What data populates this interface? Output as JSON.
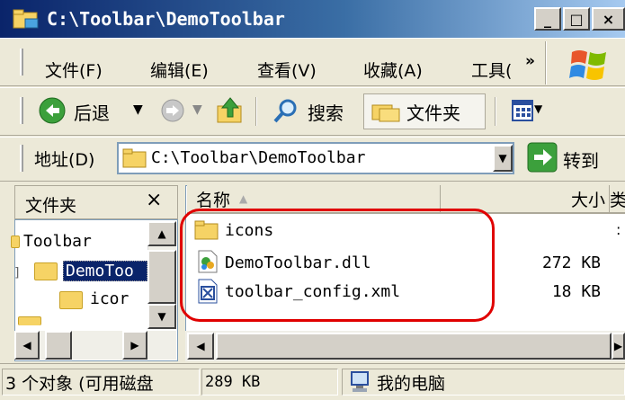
{
  "window": {
    "title": "C:\\Toolbar\\DemoToolbar",
    "controls": {
      "minimize": "_",
      "maximize": "□",
      "close": "×"
    }
  },
  "menu": {
    "items": [
      "文件(F)",
      "编辑(E)",
      "查看(V)",
      "收藏(A)",
      "工具("
    ],
    "overflow": "»"
  },
  "toolbar": {
    "back": "后退",
    "search": "搜索",
    "folders": "文件夹"
  },
  "address": {
    "label": "地址(D)",
    "value": "C:\\Toolbar\\DemoToolbar",
    "go": "转到"
  },
  "folder_pane": {
    "title": "文件夹",
    "close": "×",
    "tree": [
      {
        "label": "Toolbar"
      },
      {
        "label": "DemoToo",
        "selected": true
      },
      {
        "label": "icor"
      }
    ]
  },
  "file_list": {
    "columns": {
      "name": "名称",
      "size": "大小",
      "extra": "类"
    },
    "rows": [
      {
        "name": "icons",
        "size": "",
        "type": "folder"
      },
      {
        "name": "DemoToolbar.dll",
        "size": "272 KB",
        "type": "dll"
      },
      {
        "name": "toolbar_config.xml",
        "size": "18 KB",
        "type": "xml"
      }
    ],
    "highlight_color": "#e00000"
  },
  "status": {
    "objects": "3 个对象 (可用磁盘",
    "size": "289 KB",
    "location": "我的电脑"
  }
}
